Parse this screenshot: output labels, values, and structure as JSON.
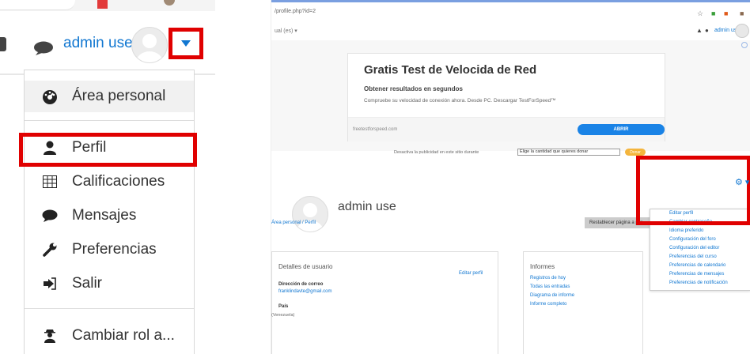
{
  "left_panel": {
    "user_name": "admin use",
    "menu": [
      {
        "label": "Área personal",
        "icon": "dashboard-icon",
        "active": true
      },
      {
        "label": "Perfil",
        "icon": "user-icon",
        "highlighted": true
      },
      {
        "label": "Calificaciones",
        "icon": "table-icon"
      },
      {
        "label": "Mensajes",
        "icon": "chat-icon"
      },
      {
        "label": "Preferencias",
        "icon": "wrench-icon"
      },
      {
        "label": "Salir",
        "icon": "sign-out-icon"
      },
      {
        "label": "Cambiar rol a...",
        "icon": "user-secret-icon"
      }
    ]
  },
  "right_panel": {
    "browser": {
      "url": "/profile.php?id=2"
    },
    "header": {
      "crumb": "ual (es) ▾",
      "user_name": "admin use"
    },
    "ad": {
      "title": "Gratis Test de Velocida de Red",
      "subtitle": "Obtener resultados en segundos",
      "description": "Compruebe su velocidad de conexión ahora. Desde PC. Descargar TestForSpeed™",
      "site": "freetestforspeed.com",
      "button": "ABRIR"
    },
    "donate": {
      "text": "Desactiva la publicidad en este sitio durante",
      "select": "Elige la cantidad que quieres donar",
      "button": "Donar"
    },
    "profile_name": "admin use",
    "breadcrumb": "Área personal / Perfil",
    "reset_button": "Restablecer página a por",
    "gear_menu": [
      "Editar perfil",
      "Cambiar contraseña",
      "Idioma preferido",
      "Configuración del foro",
      "Configuración del editor",
      "Preferencias del curso",
      "Preferencias de calendario",
      "Preferencias de mensajes",
      "Preferencias de notificación"
    ],
    "user_details": {
      "heading": "Detalles de usuario",
      "edit_link": "Editar perfil",
      "email_label": "Dirección de correo",
      "email_value": "franklindavte@gmail.com",
      "country_label": "País"
    },
    "reports": {
      "heading": "Informes",
      "links": [
        "Registros de hoy",
        "Todas las entradas",
        "Diagrama de informe",
        "Informe completo"
      ]
    },
    "cutoff_text": "(Venezuela)"
  },
  "colors": {
    "link": "#1177d1",
    "highlight": "#e00000"
  }
}
